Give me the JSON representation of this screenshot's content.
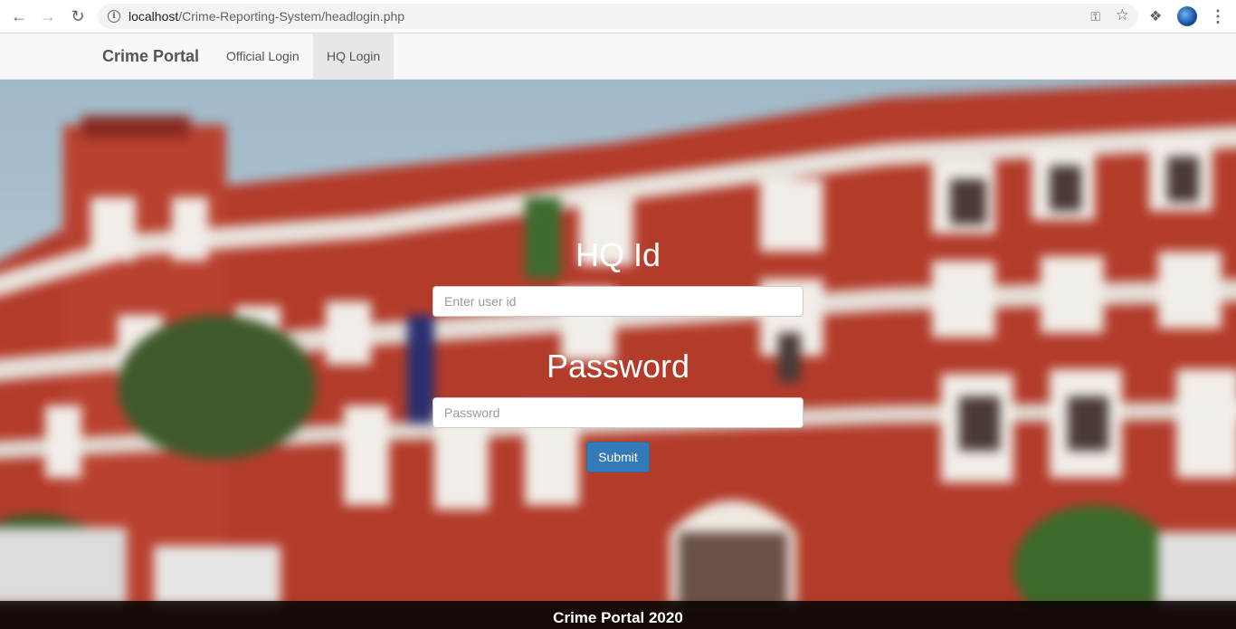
{
  "browser": {
    "url_host": "localhost",
    "url_path": "/Crime-Reporting-System/headlogin.php",
    "icons": [
      "back-arrow-icon",
      "forward-arrow-icon",
      "reload-icon",
      "info-icon",
      "key-icon",
      "star-icon",
      "extensions-icon",
      "profile-avatar",
      "more-menu-icon"
    ]
  },
  "navbar": {
    "brand": "Crime Portal",
    "links": [
      {
        "label": "Official Login",
        "active": false
      },
      {
        "label": "HQ Login",
        "active": true
      }
    ]
  },
  "form": {
    "hq_id_label": "HQ Id",
    "user_placeholder": "Enter user id",
    "password_label": "Password",
    "password_placeholder": "Password",
    "submit_label": "Submit"
  },
  "footer": {
    "text": "Crime Portal 2020"
  },
  "colors": {
    "primary_button": "#337ab7",
    "navbar_bg": "#f8f8f8",
    "building_red": "#b9412f"
  }
}
